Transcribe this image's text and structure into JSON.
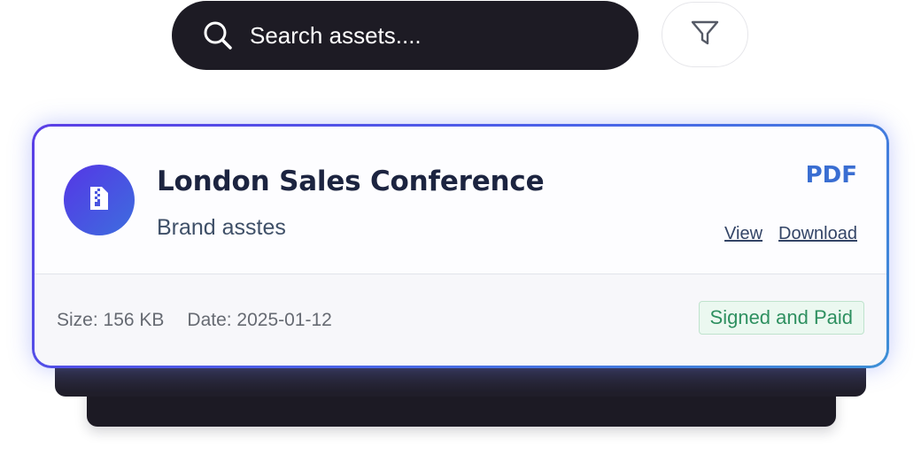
{
  "search": {
    "placeholder": "Search assets....",
    "icon": "search-icon"
  },
  "filter": {
    "icon": "filter-icon"
  },
  "asset": {
    "title": "London Sales Conference",
    "subtitle": "Brand asstes",
    "file_type": "PDF",
    "icon": "file-zip-icon",
    "actions": {
      "view": "View",
      "download": "Download"
    },
    "meta": {
      "size": "Size: 156 KB",
      "date": "Date: 2025-01-12"
    },
    "status": "Signed and Paid"
  },
  "colors": {
    "accent": "#3a6ed2",
    "card_border_start": "#5a3ee6",
    "card_border_end": "#3d8fd6",
    "search_bg": "#1d1b24",
    "status_text": "#2e9060",
    "status_bg": "#ebf8f0"
  }
}
